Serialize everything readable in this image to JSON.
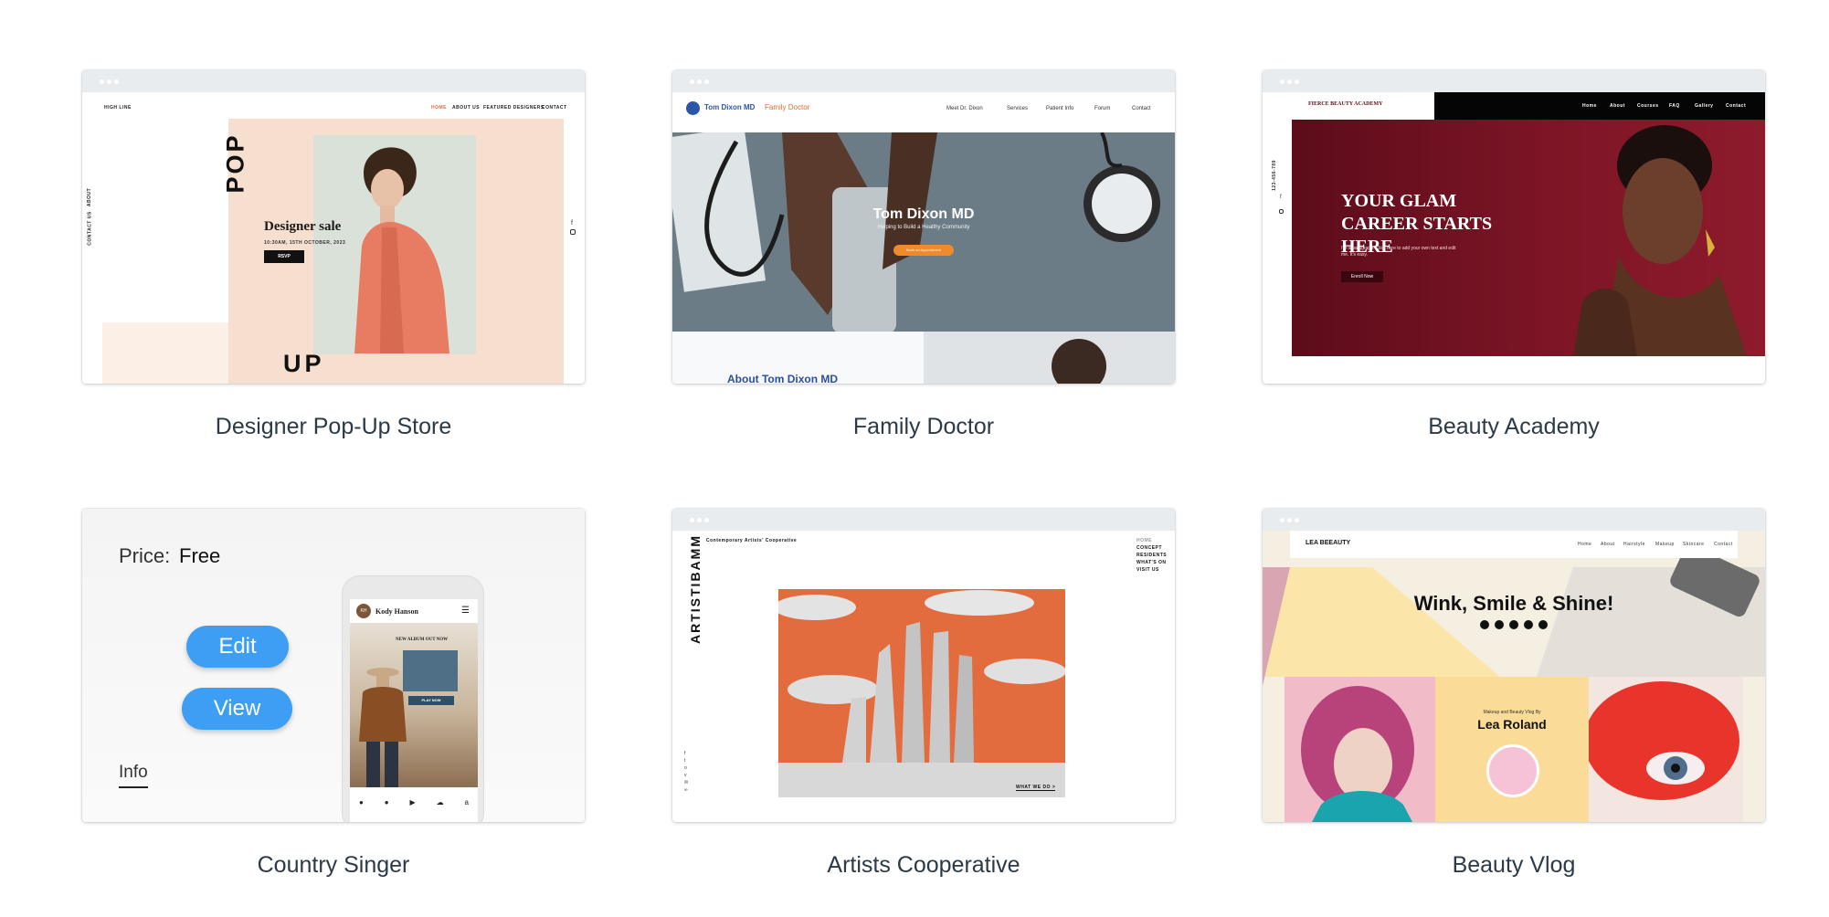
{
  "templates": [
    {
      "caption": "Designer Pop-Up Store",
      "preview": {
        "logo": "HIGH LINE",
        "nav": [
          "HOME",
          "ABOUT US",
          "FEATURED DESIGNERS",
          "CONTACT"
        ],
        "side_links": [
          "ABOUT",
          "CONTACT US"
        ],
        "word_top": "POP",
        "word_bottom": "UP",
        "headline": "Designer sale",
        "date": "10:30AM, 15TH OCTOBER, 2023",
        "button": "RSVP"
      }
    },
    {
      "caption": "Family Doctor",
      "preview": {
        "logo_name": "Tom Dixon MD",
        "logo_tag": "Family Doctor",
        "nav": [
          "Meet Dr. Dixon",
          "Services",
          "Patient Info",
          "Forum",
          "Contact"
        ],
        "hero_title": "Tom Dixon MD",
        "hero_sub": "Helping to Build a Healthy Community",
        "hero_button": "Book an Appointment",
        "about": "About Tom Dixon MD"
      }
    },
    {
      "caption": "Beauty Academy",
      "preview": {
        "logo": "FIERCE BEAUTY ACADEMY",
        "nav": [
          "Home",
          "About",
          "Courses",
          "FAQ",
          "Gallery",
          "Contact"
        ],
        "phone": "123-456-789",
        "headline": "YOUR GLAM CAREER STARTS HERE",
        "body": "I'm a paragraph. Click here to add your own text and edit me. It's easy.",
        "button": "Enroll Now"
      }
    },
    {
      "caption": "Country Singer",
      "overlay": {
        "price_label": "Price:",
        "price_value": "Free",
        "edit": "Edit",
        "view": "View",
        "info": "Info"
      },
      "preview": {
        "avatar": "KH",
        "name": "Kody Hanson",
        "promo": "NEW ALBUM OUT NOW",
        "button": "PLAY NOW"
      }
    },
    {
      "caption": "Artists Cooperative",
      "preview": {
        "brand": "ARTISTIBAMM",
        "tagline": "Contemporary Artists' Cooperative",
        "nav": [
          "HOME",
          "CONCEPT",
          "RESIDENTS",
          "WHAT'S ON",
          "VISIT US"
        ],
        "cta": "WHAT WE DO >"
      }
    },
    {
      "caption": "Beauty Vlog",
      "preview": {
        "logo": "LEA BEEAUTY",
        "nav": [
          "Home",
          "About",
          "Hairstyle",
          "Makeup",
          "Skincare",
          "Contact"
        ],
        "headline": "Wink, Smile & Shine!",
        "subtitle": "Makeup and Beauty Vlog By",
        "name": "Lea Roland"
      }
    }
  ]
}
